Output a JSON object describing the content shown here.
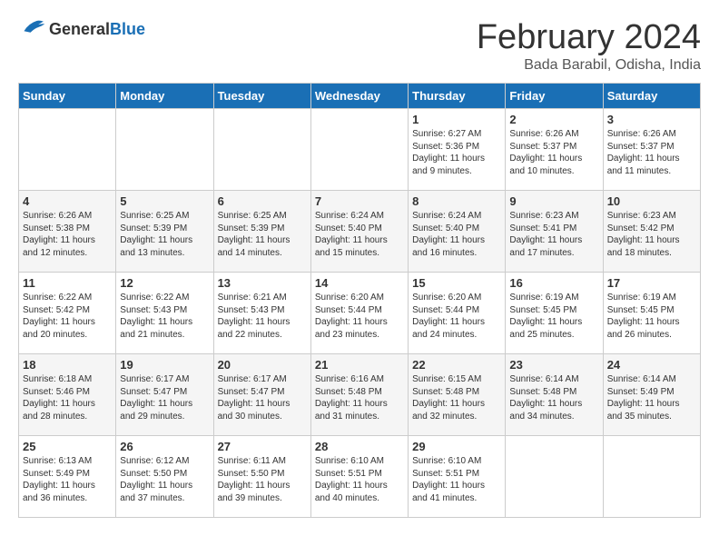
{
  "header": {
    "logo_general": "General",
    "logo_blue": "Blue",
    "month_year": "February 2024",
    "location": "Bada Barabil, Odisha, India"
  },
  "days_of_week": [
    "Sunday",
    "Monday",
    "Tuesday",
    "Wednesday",
    "Thursday",
    "Friday",
    "Saturday"
  ],
  "weeks": [
    [
      {
        "day": "",
        "info": ""
      },
      {
        "day": "",
        "info": ""
      },
      {
        "day": "",
        "info": ""
      },
      {
        "day": "",
        "info": ""
      },
      {
        "day": "1",
        "info": "Sunrise: 6:27 AM\nSunset: 5:36 PM\nDaylight: 11 hours\nand 9 minutes."
      },
      {
        "day": "2",
        "info": "Sunrise: 6:26 AM\nSunset: 5:37 PM\nDaylight: 11 hours\nand 10 minutes."
      },
      {
        "day": "3",
        "info": "Sunrise: 6:26 AM\nSunset: 5:37 PM\nDaylight: 11 hours\nand 11 minutes."
      }
    ],
    [
      {
        "day": "4",
        "info": "Sunrise: 6:26 AM\nSunset: 5:38 PM\nDaylight: 11 hours\nand 12 minutes."
      },
      {
        "day": "5",
        "info": "Sunrise: 6:25 AM\nSunset: 5:39 PM\nDaylight: 11 hours\nand 13 minutes."
      },
      {
        "day": "6",
        "info": "Sunrise: 6:25 AM\nSunset: 5:39 PM\nDaylight: 11 hours\nand 14 minutes."
      },
      {
        "day": "7",
        "info": "Sunrise: 6:24 AM\nSunset: 5:40 PM\nDaylight: 11 hours\nand 15 minutes."
      },
      {
        "day": "8",
        "info": "Sunrise: 6:24 AM\nSunset: 5:40 PM\nDaylight: 11 hours\nand 16 minutes."
      },
      {
        "day": "9",
        "info": "Sunrise: 6:23 AM\nSunset: 5:41 PM\nDaylight: 11 hours\nand 17 minutes."
      },
      {
        "day": "10",
        "info": "Sunrise: 6:23 AM\nSunset: 5:42 PM\nDaylight: 11 hours\nand 18 minutes."
      }
    ],
    [
      {
        "day": "11",
        "info": "Sunrise: 6:22 AM\nSunset: 5:42 PM\nDaylight: 11 hours\nand 20 minutes."
      },
      {
        "day": "12",
        "info": "Sunrise: 6:22 AM\nSunset: 5:43 PM\nDaylight: 11 hours\nand 21 minutes."
      },
      {
        "day": "13",
        "info": "Sunrise: 6:21 AM\nSunset: 5:43 PM\nDaylight: 11 hours\nand 22 minutes."
      },
      {
        "day": "14",
        "info": "Sunrise: 6:20 AM\nSunset: 5:44 PM\nDaylight: 11 hours\nand 23 minutes."
      },
      {
        "day": "15",
        "info": "Sunrise: 6:20 AM\nSunset: 5:44 PM\nDaylight: 11 hours\nand 24 minutes."
      },
      {
        "day": "16",
        "info": "Sunrise: 6:19 AM\nSunset: 5:45 PM\nDaylight: 11 hours\nand 25 minutes."
      },
      {
        "day": "17",
        "info": "Sunrise: 6:19 AM\nSunset: 5:45 PM\nDaylight: 11 hours\nand 26 minutes."
      }
    ],
    [
      {
        "day": "18",
        "info": "Sunrise: 6:18 AM\nSunset: 5:46 PM\nDaylight: 11 hours\nand 28 minutes."
      },
      {
        "day": "19",
        "info": "Sunrise: 6:17 AM\nSunset: 5:47 PM\nDaylight: 11 hours\nand 29 minutes."
      },
      {
        "day": "20",
        "info": "Sunrise: 6:17 AM\nSunset: 5:47 PM\nDaylight: 11 hours\nand 30 minutes."
      },
      {
        "day": "21",
        "info": "Sunrise: 6:16 AM\nSunset: 5:48 PM\nDaylight: 11 hours\nand 31 minutes."
      },
      {
        "day": "22",
        "info": "Sunrise: 6:15 AM\nSunset: 5:48 PM\nDaylight: 11 hours\nand 32 minutes."
      },
      {
        "day": "23",
        "info": "Sunrise: 6:14 AM\nSunset: 5:48 PM\nDaylight: 11 hours\nand 34 minutes."
      },
      {
        "day": "24",
        "info": "Sunrise: 6:14 AM\nSunset: 5:49 PM\nDaylight: 11 hours\nand 35 minutes."
      }
    ],
    [
      {
        "day": "25",
        "info": "Sunrise: 6:13 AM\nSunset: 5:49 PM\nDaylight: 11 hours\nand 36 minutes."
      },
      {
        "day": "26",
        "info": "Sunrise: 6:12 AM\nSunset: 5:50 PM\nDaylight: 11 hours\nand 37 minutes."
      },
      {
        "day": "27",
        "info": "Sunrise: 6:11 AM\nSunset: 5:50 PM\nDaylight: 11 hours\nand 39 minutes."
      },
      {
        "day": "28",
        "info": "Sunrise: 6:10 AM\nSunset: 5:51 PM\nDaylight: 11 hours\nand 40 minutes."
      },
      {
        "day": "29",
        "info": "Sunrise: 6:10 AM\nSunset: 5:51 PM\nDaylight: 11 hours\nand 41 minutes."
      },
      {
        "day": "",
        "info": ""
      },
      {
        "day": "",
        "info": ""
      }
    ]
  ]
}
